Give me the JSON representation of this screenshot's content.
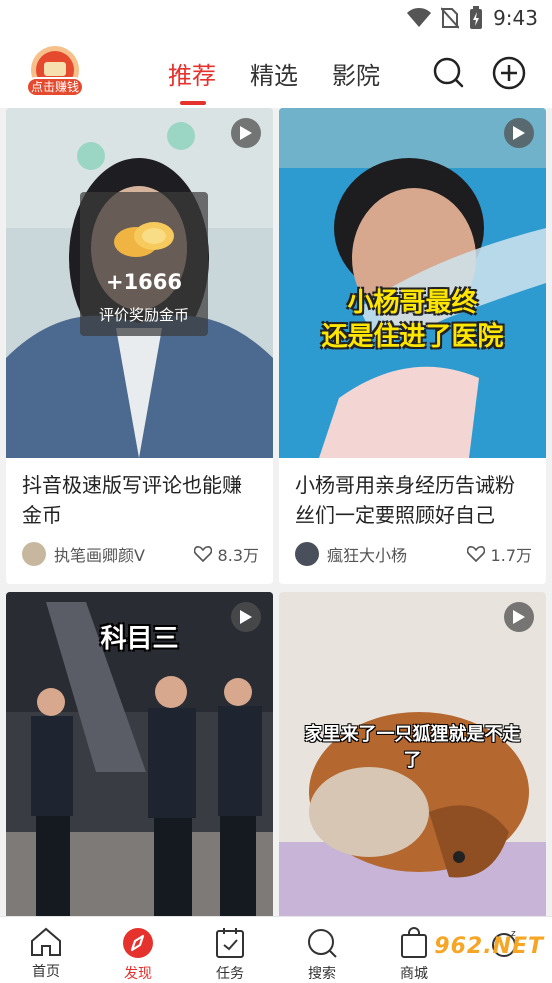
{
  "status": {
    "time": "9:43"
  },
  "header": {
    "logo_label": "点击赚钱",
    "tabs": [
      {
        "label": "推荐"
      },
      {
        "label": "精选"
      },
      {
        "label": "影院"
      }
    ]
  },
  "cards": [
    {
      "title": "抖音极速版写评论也能赚金币",
      "author": "执笔画卿颜V",
      "likes": "8.3万",
      "reward_amount": "+1666",
      "reward_label": "评价奖励金币"
    },
    {
      "title": "小杨哥用亲身经历告诫粉丝们一定要照顾好自己",
      "author": "瘋狂大小杨",
      "likes": "1.7万",
      "overlay_line1": "小杨哥最终",
      "overlay_line2": "还是住进了医院"
    },
    {
      "overlay": "科目三"
    },
    {
      "overlay_line1": "家里来了一只狐狸就是不走",
      "overlay_line2": "了"
    }
  ],
  "bottom_nav": [
    {
      "label": "首页",
      "icon": "home-icon"
    },
    {
      "label": "发现",
      "icon": "discover-icon"
    },
    {
      "label": "任务",
      "icon": "task-icon"
    },
    {
      "label": "搜索",
      "icon": "search-icon"
    },
    {
      "label": "商城",
      "icon": "bag-icon"
    },
    {
      "label": "",
      "icon": "sleep-icon"
    }
  ],
  "watermark": "962.NET",
  "colors": {
    "accent": "#e5322d",
    "bg": "#f1f1f1"
  }
}
